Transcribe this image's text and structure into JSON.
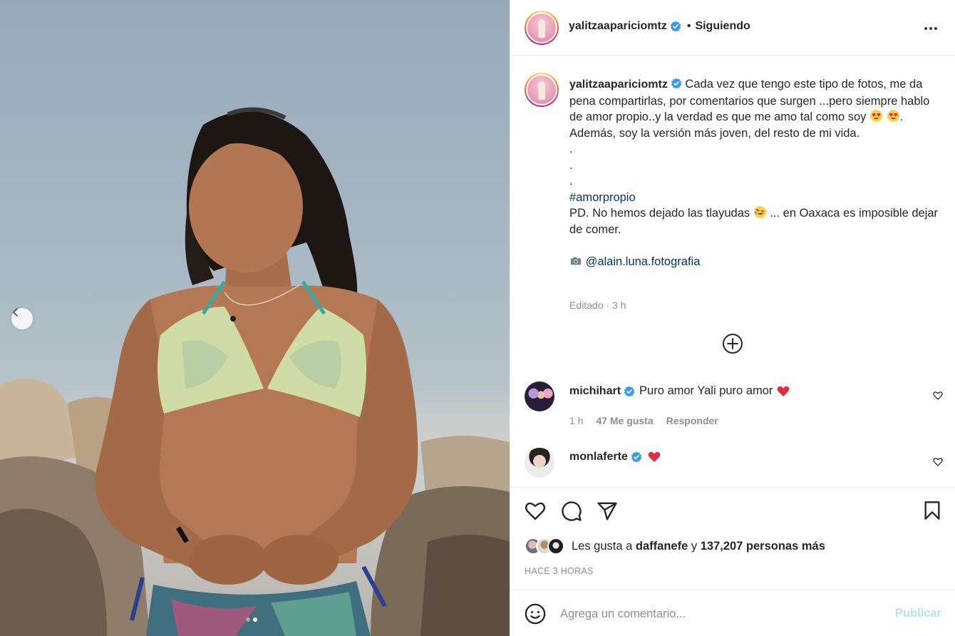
{
  "photo": {
    "alt_icon": "chevron-left-icon",
    "carousel_dots": 2,
    "active_dot": 1
  },
  "header": {
    "username": "yalitzaapariciomtz",
    "separator": "•",
    "follow_status": "Siguiendo",
    "more_icon": "more-options-icon"
  },
  "caption": {
    "username": "yalitzaapariciomtz",
    "line1": "Cada vez que tengo este tipo de fotos, me da pena compartirlas, por comentarios que surgen ...pero siempre hablo de amor propio..y la verdad es que me amo tal como soy",
    "line1_end": ".",
    "line2": "Además, soy la versión más joven, del resto de mi vida.",
    "dot1": ".",
    "dot2": ".",
    "dot3": ".",
    "hashtag": "#amorpropio",
    "line3_a": "PD. No hemos dejado las tlayudas",
    "line3_b": "... en Oaxaca es imposible dejar de comer.",
    "mention": "@alain.luna.fotografia",
    "meta_edited": "Editado",
    "meta_sep": "·",
    "meta_time": "3 h"
  },
  "comments": [
    {
      "username": "michihart",
      "text": "Puro amor Yali puro amor",
      "time": "1 h",
      "likes": "47 Me gusta",
      "reply": "Responder"
    },
    {
      "username": "monlaferte",
      "text": ""
    }
  ],
  "actions": {
    "like_icon": "heart-icon",
    "comment_icon": "comment-icon",
    "share_icon": "send-icon",
    "save_icon": "bookmark-icon"
  },
  "likes": {
    "prefix": "Les gusta a",
    "user": "daffanefe",
    "connector": "y",
    "count": "137,207 personas más"
  },
  "timestamp": "HACE 3 HORAS",
  "comment_box": {
    "placeholder": "Agrega un comentario...",
    "publish": "Publicar"
  },
  "colors": {
    "verified": "#3897f0",
    "link": "#00376b",
    "muted": "#8e8e8e",
    "publish_disabled": "#b2dffc",
    "heart": "#ed4956"
  }
}
